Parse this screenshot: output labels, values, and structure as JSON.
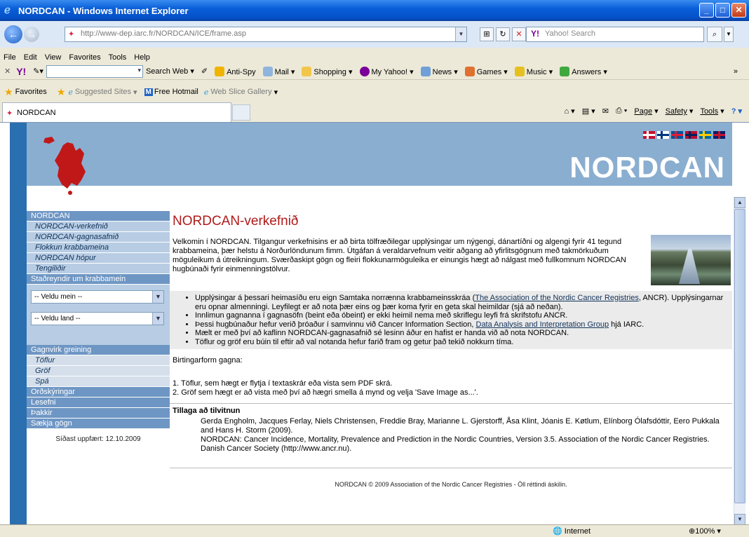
{
  "window": {
    "title": "NORDCAN - Windows Internet Explorer"
  },
  "address_bar": {
    "url": "http://www-dep.iarc.fr/NORDCAN/ICE/frame.asp",
    "search_placeholder": "Yahoo! Search"
  },
  "menu": [
    "File",
    "Edit",
    "View",
    "Favorites",
    "Tools",
    "Help"
  ],
  "yahoo_toolbar": {
    "search_web": "Search Web",
    "items": [
      "Anti-Spy",
      "Mail",
      "Shopping",
      "My Yahoo!",
      "News",
      "Games",
      "Music",
      "Answers"
    ]
  },
  "favorites_bar": {
    "favorites": "Favorites",
    "suggested": "Suggested Sites",
    "hotmail": "Free Hotmail",
    "webslice": "Web Slice Gallery"
  },
  "tab": {
    "label": "NORDCAN"
  },
  "command_bar": {
    "page": "Page",
    "safety": "Safety",
    "tools": "Tools"
  },
  "page": {
    "brand": "NORDCAN",
    "sidebar": {
      "head_nordcan": "NORDCAN",
      "items": [
        "NORDCAN-verkefnið",
        "NORDCAN-gagnasafnið",
        "Flokkun krabbameina",
        "NORDCAN hópur",
        "Tengiliðir"
      ],
      "facts_head": "Staðreyndir um krabbamein",
      "select_cancer": "-- Veldu mein --",
      "select_country": "-- Veldu land --",
      "analysis_head": "Gagnvirk greining",
      "analysis_items": [
        "Töflur",
        "Gröf",
        "Spá"
      ],
      "glossary": "Orðskýringar",
      "reading": "Lesefni",
      "thanks": "Þakkir",
      "download": "Sækja gögn",
      "updated": "Síðast uppfært: 12.10.2009"
    },
    "title": "NORDCAN-verkefnið",
    "intro": "Velkomin í NORDCAN. Tilgangur verkefnisins er að birta tölfræðilegar upplýsingar um nýgengi, dánartíðni og algengi fyrir 41 tegund krabbameina, þær helstu á Norðurlöndunum fimm. Útgáfan á veraldarvefnum veitir aðgang að yfirlitsgögnum með takmörkuðum möguleikum á útreikningum. Sværðaskipt gögn og fleiri flokkunarmöguleika er einungis hægt að nálgast með fullkomnum NORDCAN hugbúnaði fyrir einmenningstölvur.",
    "bullets": {
      "b1_pre": "Upplýsingar á þessari heimasíðu eru eign Samtaka norrænna krabbameinsskráa (",
      "b1_link": "The Association of the Nordic Cancer Registries",
      "b1_post": ", ANCR). Upplýsingarnar eru opnar almenningi. Leyfilegt er að nota þær eins og þær koma fyrir en geta skal heimildar (sjá að neðan).",
      "b2": "Innlimun gagnanna í gagnasöfn (beint eða óbeint) er ekki heimil nema með skriflegu leyfi frá skrifstofu ANCR.",
      "b3_pre": "Þessi hugbúnaður hefur verið þróaður í samvinnu við Cancer Information Section, ",
      "b3_link": "Data Analysis and Interpretation Group",
      "b3_post": " hjá IARC.",
      "b4": "Mælt er með því að kaflinn NORDCAN-gagnasafnið sé lesinn áður en hafist er handa við að nota NORDCAN.",
      "b5": "Töflur og gröf eru búin til eftir að val notanda hefur farið fram og getur það tekið nokkurn tíma."
    },
    "output_heading": "Birtingarform gagna:",
    "output_1": "1. Töflur, sem hægt er flytja í textaskrár eða vista sem PDF skrá.",
    "output_2": "2. Gröf sem hægt er að vista með því að hægri smella á mynd og velja 'Save Image as...'.",
    "citation_heading": "Tillaga að tilvitnun",
    "citation_1": "Gerda Engholm, Jacques Ferlay, Niels Christensen, Freddie Bray, Marianne L. Gjerstorff, Åsa Klint, Jóanis E. Køtlum, Elínborg Ólafsdóttir, Eero Pukkala and Hans H. Storm (2009).",
    "citation_2": "NORDCAN: Cancer Incidence, Mortality, Prevalence and Prediction in the Nordic Countries, Version 3.5. Association of the Nordic Cancer Registries. Danish Cancer Society (http://www.ancr.nu).",
    "footer": "NORDCAN © 2009 Association of the Nordic Cancer Registries - Öll réttindi áskilin."
  },
  "status_bar": {
    "zone": "Internet",
    "zoom": "100%"
  }
}
